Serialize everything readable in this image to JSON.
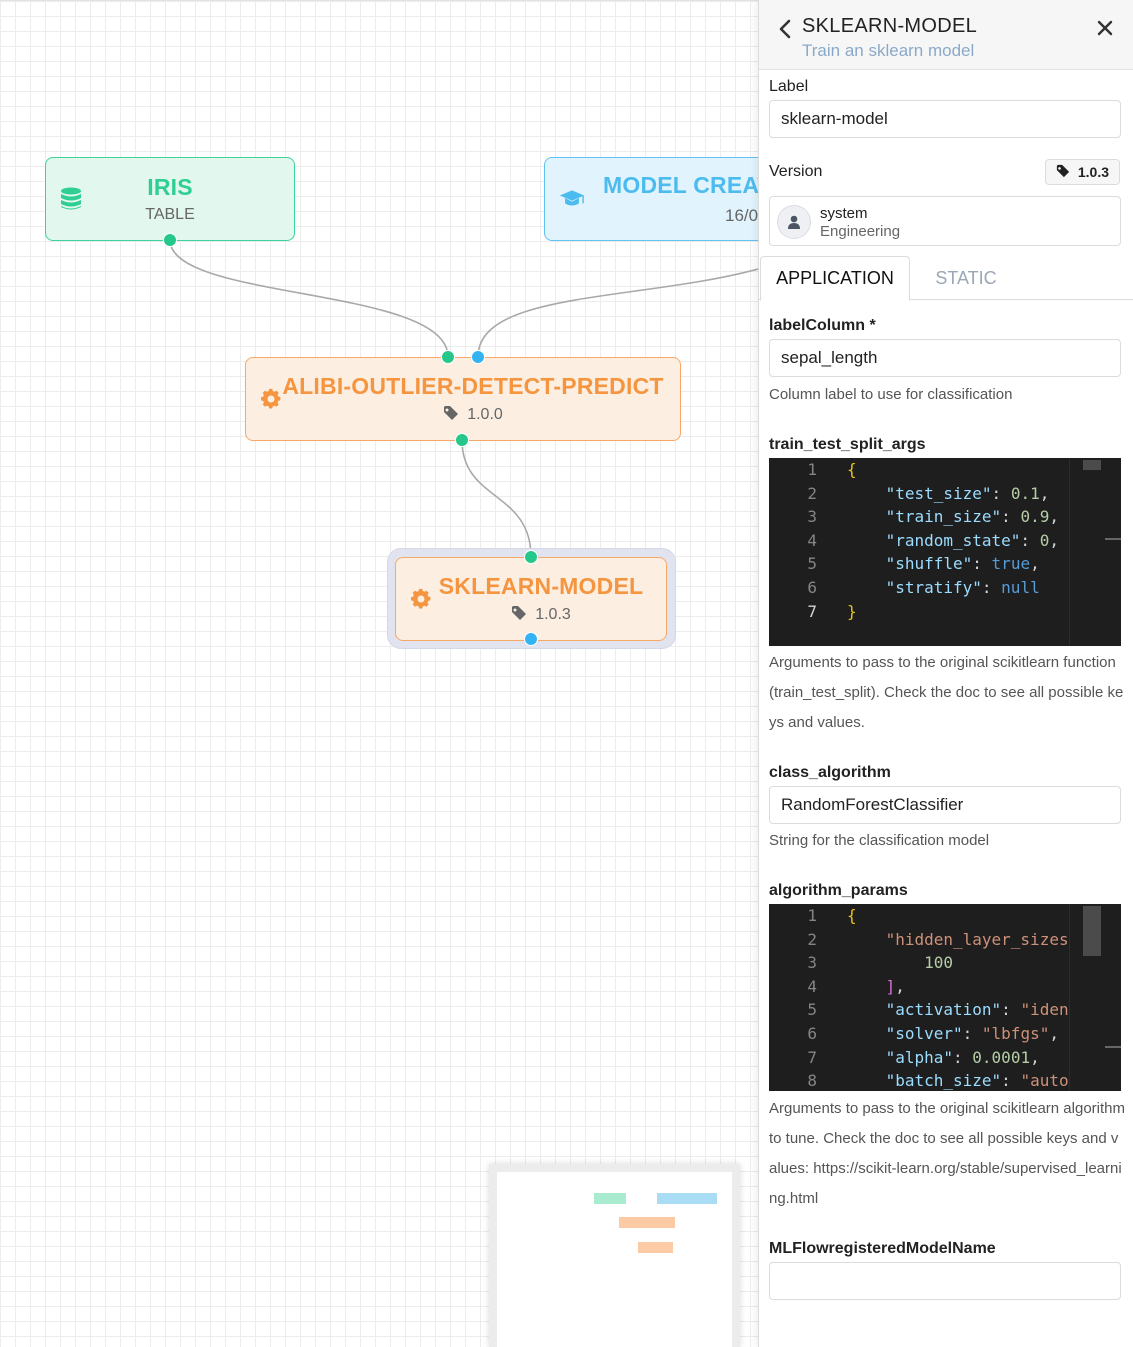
{
  "canvas": {
    "nodes": [
      {
        "id": "iris",
        "title": "IRIS",
        "subtitle": "TABLE",
        "theme": "green",
        "icon": "database-icon"
      },
      {
        "id": "model-creat",
        "title": "MODEL CREAT",
        "subtitle": "16/0",
        "theme": "blue",
        "icon": "graduation-cap-icon"
      },
      {
        "id": "alibi",
        "title": "ALIBI-OUTLIER-DETECT-PREDICT",
        "subtitle": "1.0.0",
        "theme": "orange",
        "icon": "gear-icon"
      },
      {
        "id": "sklearn",
        "title": "SKLEARN-MODEL",
        "subtitle": "1.0.3",
        "theme": "orange",
        "icon": "gear-icon",
        "selected": true
      }
    ],
    "colors": {
      "green": "#2fce92",
      "blue": "#4cbcf0",
      "orange": "#f5953f",
      "edge": "#a9a9a9"
    }
  },
  "panel": {
    "title": "SKLEARN-MODEL",
    "subtitle": "Train an sklearn model",
    "label_label": "Label",
    "label_value": "sklearn-model",
    "version_label": "Version",
    "version_value": "1.0.3",
    "owner_name": "system",
    "owner_team": "Engineering",
    "tabs": [
      "APPLICATION",
      "STATIC"
    ],
    "active_tab": "APPLICATION",
    "fields": {
      "labelColumn": {
        "label": "labelColumn *",
        "value": "sepal_length",
        "hint": "Column label to use for classification"
      },
      "train_test_split_args": {
        "label": "train_test_split_args",
        "hint": "Arguments to pass to the original scikitlearn function (train_test_split). Check the doc to see all possible keys and values."
      },
      "class_algorithm": {
        "label": "class_algorithm",
        "value": "RandomForestClassifier",
        "hint": "String for the classification model"
      },
      "algorithm_params": {
        "label": "algorithm_params",
        "hint": "Arguments to pass to the original scikitlearn algorithm to tune. Check the doc to see all possible keys and values: https://scikit-learn.org/stable/supervised_learning.html"
      },
      "MLFlowregisteredModelName": {
        "label": "MLFlowregisteredModelName",
        "value": ""
      }
    },
    "code1": [
      {
        "n": "1",
        "t": "{"
      },
      {
        "n": "2",
        "t": "    \"test_size\": 0.1,"
      },
      {
        "n": "3",
        "t": "    \"train_size\": 0.9,"
      },
      {
        "n": "4",
        "t": "    \"random_state\": 0,"
      },
      {
        "n": "5",
        "t": "    \"shuffle\": true,"
      },
      {
        "n": "6",
        "t": "    \"stratify\": null"
      },
      {
        "n": "7",
        "t": "}"
      }
    ],
    "code2": [
      {
        "n": "1",
        "t": "{"
      },
      {
        "n": "2",
        "t": "    \"hidden_layer_sizes"
      },
      {
        "n": "3",
        "t": "        100"
      },
      {
        "n": "4",
        "t": "    ],"
      },
      {
        "n": "5",
        "t": "    \"activation\": \"iden"
      },
      {
        "n": "6",
        "t": "    \"solver\": \"lbfgs\","
      },
      {
        "n": "7",
        "t": "    \"alpha\": 0.0001,"
      },
      {
        "n": "8",
        "t": "    \"batch_size\": \"auto"
      }
    ]
  }
}
